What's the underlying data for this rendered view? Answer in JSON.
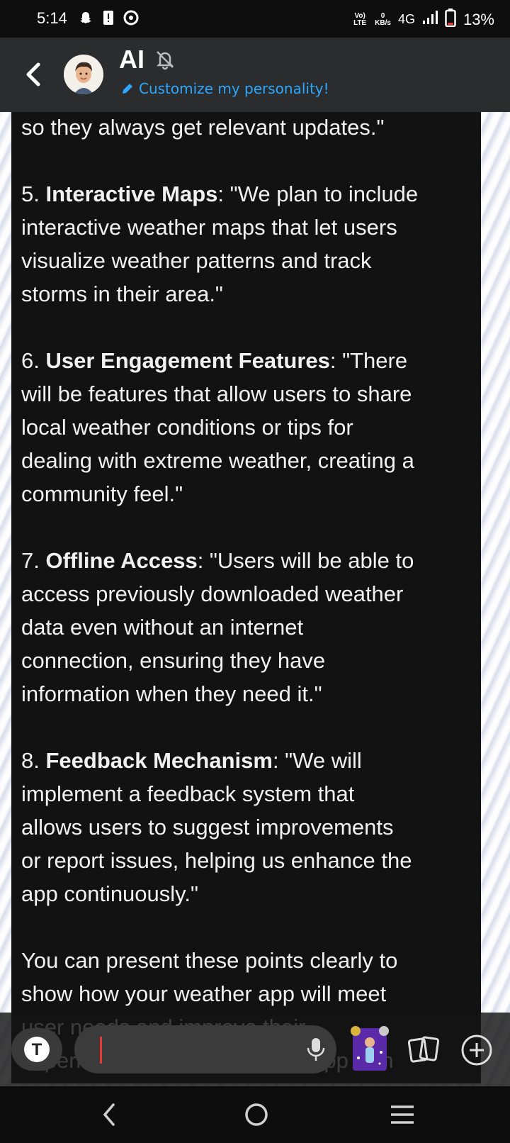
{
  "status_bar": {
    "time": "5:14",
    "volte": "Vo) LTE",
    "speed_value": "0",
    "speed_unit": "KB/s",
    "network": "4G",
    "battery": "13%"
  },
  "header": {
    "title": "AI",
    "customize_label": "Customize my personality!"
  },
  "message": {
    "lines": [
      {
        "pre": "so they always get relevant updates.\"",
        "bold": "",
        "post": ""
      },
      {
        "pre": "",
        "bold": "",
        "post": ""
      },
      {
        "pre": "5. ",
        "bold": "Interactive Maps",
        "post": ": \"We plan to include"
      },
      {
        "pre": "interactive weather maps that let users",
        "bold": "",
        "post": ""
      },
      {
        "pre": "visualize weather patterns and track",
        "bold": "",
        "post": ""
      },
      {
        "pre": "storms in their area.\"",
        "bold": "",
        "post": ""
      },
      {
        "pre": "",
        "bold": "",
        "post": ""
      },
      {
        "pre": "6. ",
        "bold": "User Engagement Features",
        "post": ": \"There"
      },
      {
        "pre": "will be features that allow users to share",
        "bold": "",
        "post": ""
      },
      {
        "pre": "local weather conditions or tips for",
        "bold": "",
        "post": ""
      },
      {
        "pre": "dealing with extreme weather, creating a",
        "bold": "",
        "post": ""
      },
      {
        "pre": "community feel.\"",
        "bold": "",
        "post": ""
      },
      {
        "pre": "",
        "bold": "",
        "post": ""
      },
      {
        "pre": "7. ",
        "bold": "Offline Access",
        "post": ": \"Users will be able to"
      },
      {
        "pre": "access previously downloaded weather",
        "bold": "",
        "post": ""
      },
      {
        "pre": "data even without an internet",
        "bold": "",
        "post": ""
      },
      {
        "pre": "connection, ensuring they have",
        "bold": "",
        "post": ""
      },
      {
        "pre": "information when they need it.\"",
        "bold": "",
        "post": ""
      },
      {
        "pre": "",
        "bold": "",
        "post": ""
      },
      {
        "pre": "8. ",
        "bold": "Feedback Mechanism",
        "post": ": \"We will"
      },
      {
        "pre": "implement a feedback system that",
        "bold": "",
        "post": ""
      },
      {
        "pre": "allows users to suggest improvements",
        "bold": "",
        "post": ""
      },
      {
        "pre": "or report issues, helping us enhance the",
        "bold": "",
        "post": ""
      },
      {
        "pre": "app continuously.\"",
        "bold": "",
        "post": ""
      },
      {
        "pre": "",
        "bold": "",
        "post": ""
      },
      {
        "pre": "You can present these points clearly to",
        "bold": "",
        "post": ""
      },
      {
        "pre": "show how your weather app will meet",
        "bold": "",
        "post": ""
      },
      {
        "pre": "user needs and improve their",
        "bold": "",
        "post": ""
      },
      {
        "pre": "experience everyday with the app with",
        "bold": "",
        "post": ""
      }
    ]
  },
  "composer": {
    "t_label": "T"
  },
  "colors": {
    "accent": "#2ea7ff",
    "chat_bg": "#121212",
    "header_bg": "#2b2c2e",
    "cursor": "#e53935"
  },
  "icons": [
    "snapchat-ghost-icon",
    "sim-alert-icon",
    "app-icon",
    "signal-icon",
    "battery-icon",
    "back-chevron-icon",
    "bell-off-icon",
    "pencil-icon",
    "microphone-icon",
    "cards-icon",
    "plus-circle-icon",
    "nav-back-icon",
    "nav-home-icon",
    "nav-menu-icon"
  ]
}
